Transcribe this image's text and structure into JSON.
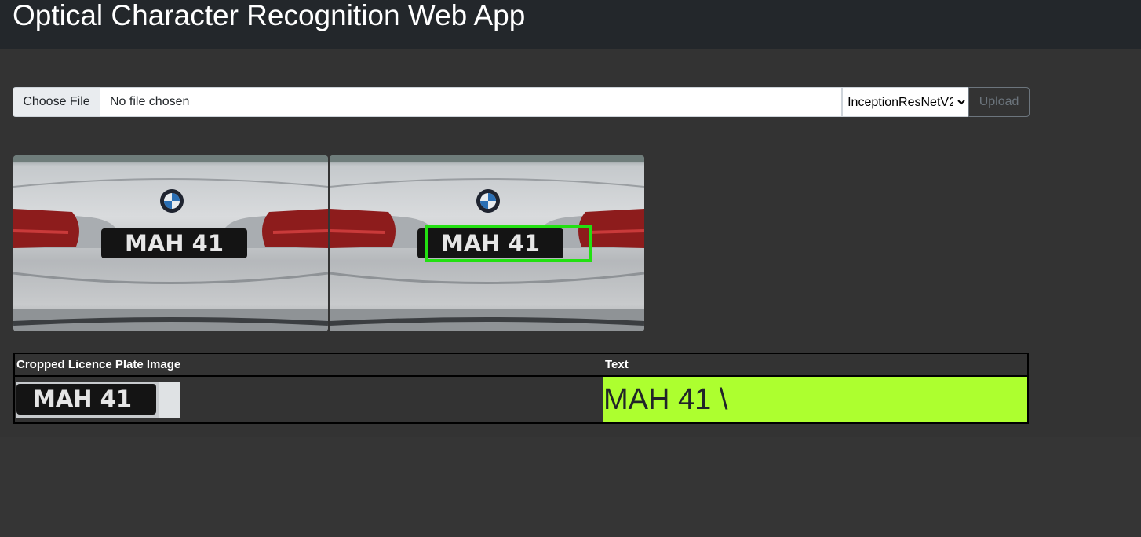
{
  "app": {
    "title": "Optical Character Recognition Web App"
  },
  "upload": {
    "choose_label": "Choose File",
    "file_status": "No file chosen",
    "model_selected": "InceptionResNetV2",
    "upload_label": "Upload"
  },
  "plate": {
    "text": "MAH 41"
  },
  "table": {
    "headers": [
      "Cropped Licence Plate Image",
      "Text"
    ],
    "rows": [
      {
        "text": "MAH 41 \\"
      }
    ]
  },
  "colors": {
    "detection_box": "#22e011",
    "result_highlight": "#adff2f"
  }
}
